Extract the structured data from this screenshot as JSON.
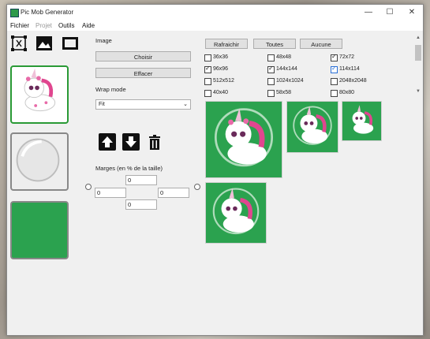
{
  "window": {
    "title": "Pic Mob Generator"
  },
  "menu": [
    "Fichier",
    "Projet",
    "Outils",
    "Aide"
  ],
  "toolbar": {
    "icons": [
      "mesh-icon",
      "image-icon",
      "frame-icon"
    ]
  },
  "panel": {
    "image_label": "Image",
    "choose_button": "Choisir",
    "clear_button": "Effacer",
    "wrap_label": "Wrap mode",
    "wrap_value": "Fit",
    "margins_label": "Marges (en % de la taille)",
    "margin_top": "0",
    "margin_left": "0",
    "margin_right": "0",
    "margin_bottom": "0"
  },
  "actions": {
    "refresh_button": "Rafraichir",
    "all_button": "Toutes",
    "none_button": "Aucune"
  },
  "sizes": [
    {
      "label": "36x36",
      "checked": false,
      "blue": false
    },
    {
      "label": "48x48",
      "checked": false,
      "blue": false
    },
    {
      "label": "72x72",
      "checked": true,
      "blue": false
    },
    {
      "label": "96x96",
      "checked": true,
      "blue": false
    },
    {
      "label": "144x144",
      "checked": true,
      "blue": false
    },
    {
      "label": "114x114",
      "checked": true,
      "blue": true
    },
    {
      "label": "512x512",
      "checked": false,
      "blue": false
    },
    {
      "label": "1024x1024",
      "checked": false,
      "blue": false
    },
    {
      "label": "2048x2048",
      "checked": false,
      "blue": false
    },
    {
      "label": "40x40",
      "checked": false,
      "blue": false
    },
    {
      "label": "58x58",
      "checked": false,
      "blue": false
    },
    {
      "label": "80x80",
      "checked": false,
      "blue": false
    }
  ],
  "colors": {
    "accent_green": "#2ba24f",
    "selected_border": "#2a9a36",
    "check_blue": "#2a6fd6"
  }
}
